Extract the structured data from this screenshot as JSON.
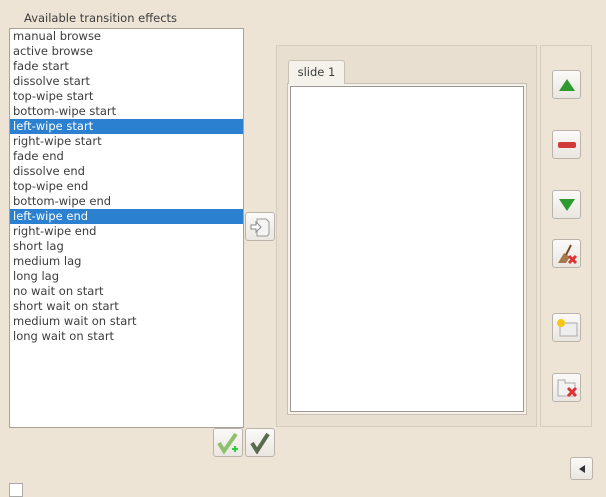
{
  "title": "Available transition effects",
  "effects": [
    "manual browse",
    "active browse",
    "fade start",
    "dissolve start",
    "top-wipe start",
    "bottom-wipe start",
    "left-wipe start",
    "right-wipe start",
    "fade end",
    "dissolve end",
    "top-wipe end",
    "bottom-wipe end",
    "left-wipe end",
    "right-wipe end",
    "short lag",
    "medium lag",
    "long lag",
    "no wait on start",
    "short wait on start",
    "medium wait on start",
    "long wait on start"
  ],
  "selected": [
    "left-wipe start",
    "left-wipe end"
  ],
  "tabs": [
    {
      "label": "slide 1"
    }
  ],
  "colors": {
    "selection": "#2b80cf",
    "background": "#ede4d6"
  }
}
